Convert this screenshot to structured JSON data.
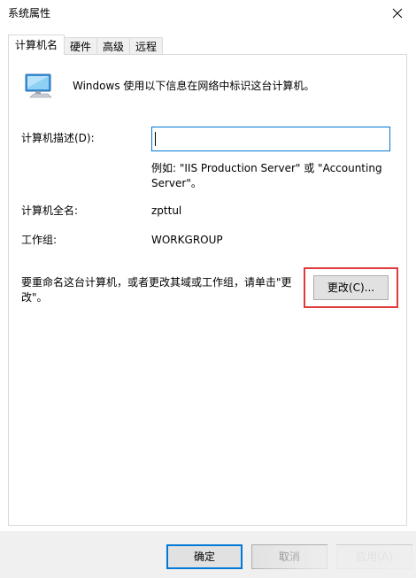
{
  "window": {
    "title": "系统属性",
    "close_icon": "close-icon"
  },
  "tabs": [
    {
      "label": "计算机名",
      "active": true
    },
    {
      "label": "硬件",
      "active": false
    },
    {
      "label": "高级",
      "active": false
    },
    {
      "label": "远程",
      "active": false
    }
  ],
  "panel": {
    "icon": "computer-icon",
    "intro": "Windows 使用以下信息在网络中标识这台计算机。",
    "description": {
      "label": "计算机描述(D):",
      "value": "",
      "example": "例如: \"IIS Production Server\" 或 \"Accounting Server\"。"
    },
    "full_name": {
      "label": "计算机全名:",
      "value": "zpttul"
    },
    "workgroup": {
      "label": "工作组:",
      "value": "WORKGROUP"
    },
    "rename": {
      "text": "要重命名这台计算机，或者更改其域或工作组，请单击\"更改\"。",
      "button": "更改(C)..."
    },
    "highlight_color": "#e03a3a"
  },
  "footer": {
    "ok": "确定",
    "cancel": "取消",
    "apply": "应用(A)"
  },
  "colors": {
    "focus": "#0078d7",
    "button_bg": "#e1e1e1",
    "footer_bg": "#f0f0f0"
  }
}
